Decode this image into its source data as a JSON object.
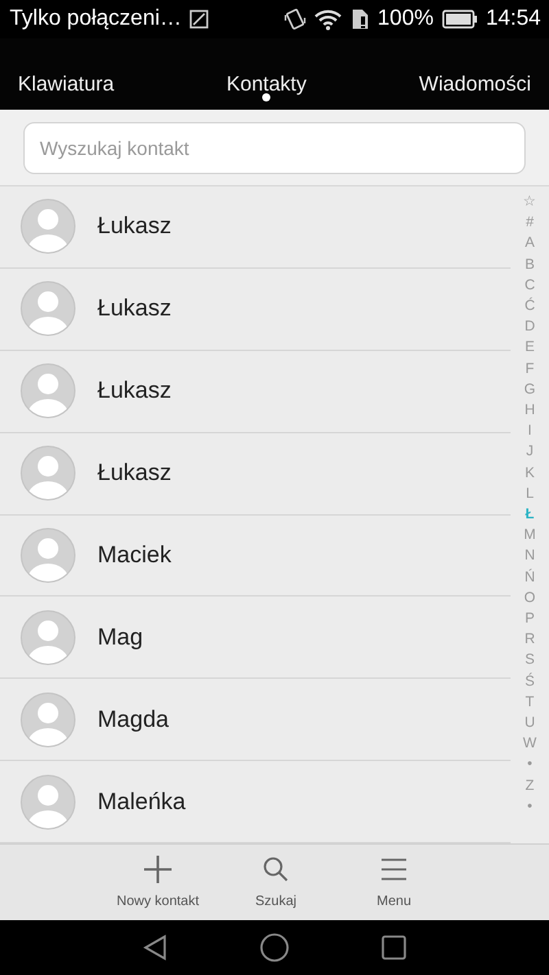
{
  "status_bar": {
    "notification": "Tylko połączeni…",
    "battery": "100%",
    "time": "14:54"
  },
  "tabs": [
    {
      "label": "Klawiatura",
      "selected": false
    },
    {
      "label": "Kontakty",
      "selected": true
    },
    {
      "label": "Wiadomości",
      "selected": false
    }
  ],
  "search": {
    "placeholder": "Wyszukaj kontakt"
  },
  "contacts": [
    {
      "name": "Łukasz"
    },
    {
      "name": "Łukasz"
    },
    {
      "name": "Łukasz"
    },
    {
      "name": "Łukasz"
    },
    {
      "name": "Maciek"
    },
    {
      "name": "Mag"
    },
    {
      "name": "Magda"
    },
    {
      "name": "Maleńka"
    }
  ],
  "index": [
    {
      "label": "☆",
      "selected": false
    },
    {
      "label": "#",
      "selected": false
    },
    {
      "label": "A",
      "selected": false
    },
    {
      "label": "B",
      "selected": false
    },
    {
      "label": "C",
      "selected": false
    },
    {
      "label": "Ć",
      "selected": false
    },
    {
      "label": "D",
      "selected": false
    },
    {
      "label": "E",
      "selected": false
    },
    {
      "label": "F",
      "selected": false
    },
    {
      "label": "G",
      "selected": false
    },
    {
      "label": "H",
      "selected": false
    },
    {
      "label": "I",
      "selected": false
    },
    {
      "label": "J",
      "selected": false
    },
    {
      "label": "K",
      "selected": false
    },
    {
      "label": "L",
      "selected": false
    },
    {
      "label": "Ł",
      "selected": true
    },
    {
      "label": "M",
      "selected": false
    },
    {
      "label": "N",
      "selected": false
    },
    {
      "label": "Ń",
      "selected": false
    },
    {
      "label": "O",
      "selected": false
    },
    {
      "label": "P",
      "selected": false
    },
    {
      "label": "R",
      "selected": false
    },
    {
      "label": "S",
      "selected": false
    },
    {
      "label": "Ś",
      "selected": false
    },
    {
      "label": "T",
      "selected": false
    },
    {
      "label": "U",
      "selected": false
    },
    {
      "label": "W",
      "selected": false
    },
    {
      "label": "•",
      "selected": false
    },
    {
      "label": "Z",
      "selected": false
    },
    {
      "label": "•",
      "selected": false
    }
  ],
  "bottom_bar": [
    {
      "kind": "add",
      "label": "Nowy kontakt"
    },
    {
      "kind": "search",
      "label": "Szukaj"
    },
    {
      "kind": "menu",
      "label": "Menu"
    }
  ]
}
